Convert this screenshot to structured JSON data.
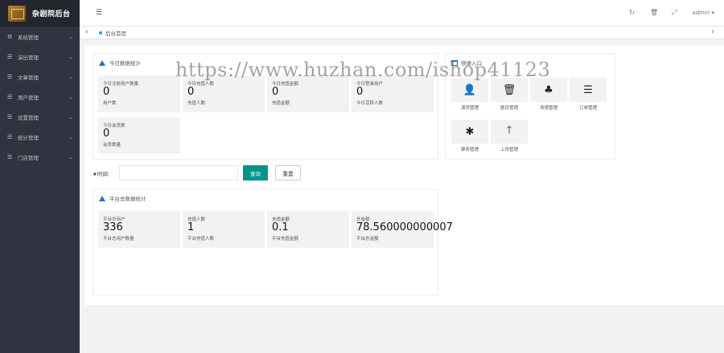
{
  "app": {
    "logo_text": "杂剧院后台"
  },
  "sidebar": {
    "items": [
      {
        "icon": "gear-icon",
        "glyph": "⚙",
        "label": "系统管理"
      },
      {
        "icon": "list-icon",
        "glyph": "☰",
        "label": "演出管理"
      },
      {
        "icon": "list-icon",
        "glyph": "☰",
        "label": "文章管理"
      },
      {
        "icon": "list-icon",
        "glyph": "☰",
        "label": "用户管理"
      },
      {
        "icon": "list-icon",
        "glyph": "☰",
        "label": "设置管理"
      },
      {
        "icon": "list-icon",
        "glyph": "☰",
        "label": "统计管理"
      },
      {
        "icon": "list-icon",
        "glyph": "☰",
        "label": "门店管理"
      }
    ]
  },
  "header": {
    "menu_icon": "☰",
    "refresh_icon": "↻",
    "trash_icon": "🗑",
    "fullscreen_icon": "⤢",
    "admin_label": "admin ▾"
  },
  "tabs": {
    "prev": "‹",
    "next": "›",
    "active_label": "后台首页"
  },
  "today": {
    "title": "今日数据统计",
    "stats": [
      {
        "label": "今日注册用户数量",
        "value": "0",
        "sub": "用户数"
      },
      {
        "label": "今日充值人数",
        "value": "0",
        "sub": "充值人数"
      },
      {
        "label": "今日充值金额",
        "value": "0",
        "sub": "充值金额"
      },
      {
        "label": "今日登录用户",
        "value": "0",
        "sub": "今日活跃人数"
      },
      {
        "label": "今日会员数",
        "value": "0",
        "sub": "会员数量"
      }
    ]
  },
  "quick": {
    "title": "快捷入口",
    "items": [
      {
        "icon": "user-icon",
        "glyph": "👤",
        "label": "演员管理"
      },
      {
        "icon": "trash-icon",
        "glyph": "🗑",
        "label": "剧目管理"
      },
      {
        "icon": "tree-icon",
        "glyph": "♣",
        "label": "场馆管理"
      },
      {
        "icon": "list-icon",
        "glyph": "☰",
        "label": "订单管理"
      },
      {
        "icon": "asterisk-icon",
        "glyph": "✱",
        "label": "票务管理"
      },
      {
        "icon": "arrow-up-icon",
        "glyph": "🡑",
        "label": "上传管理"
      }
    ]
  },
  "filter": {
    "time_label": "★时间:",
    "time_value": "",
    "search_label": "查询",
    "reset_label": "重置"
  },
  "platform": {
    "title": "平台总数据统计",
    "stats": [
      {
        "label": "平台总用户",
        "value": "336",
        "sub": "平台总用户数量"
      },
      {
        "label": "充值人数",
        "value": "1",
        "sub": "平台充值人数"
      },
      {
        "label": "充值金额",
        "value": "0.1",
        "sub": "平台充值金额"
      },
      {
        "label": "总金额",
        "value": "78.560000000007",
        "sub": "平台总金额"
      }
    ]
  },
  "watermark": "https://www.huzhan.com/ishop41123"
}
